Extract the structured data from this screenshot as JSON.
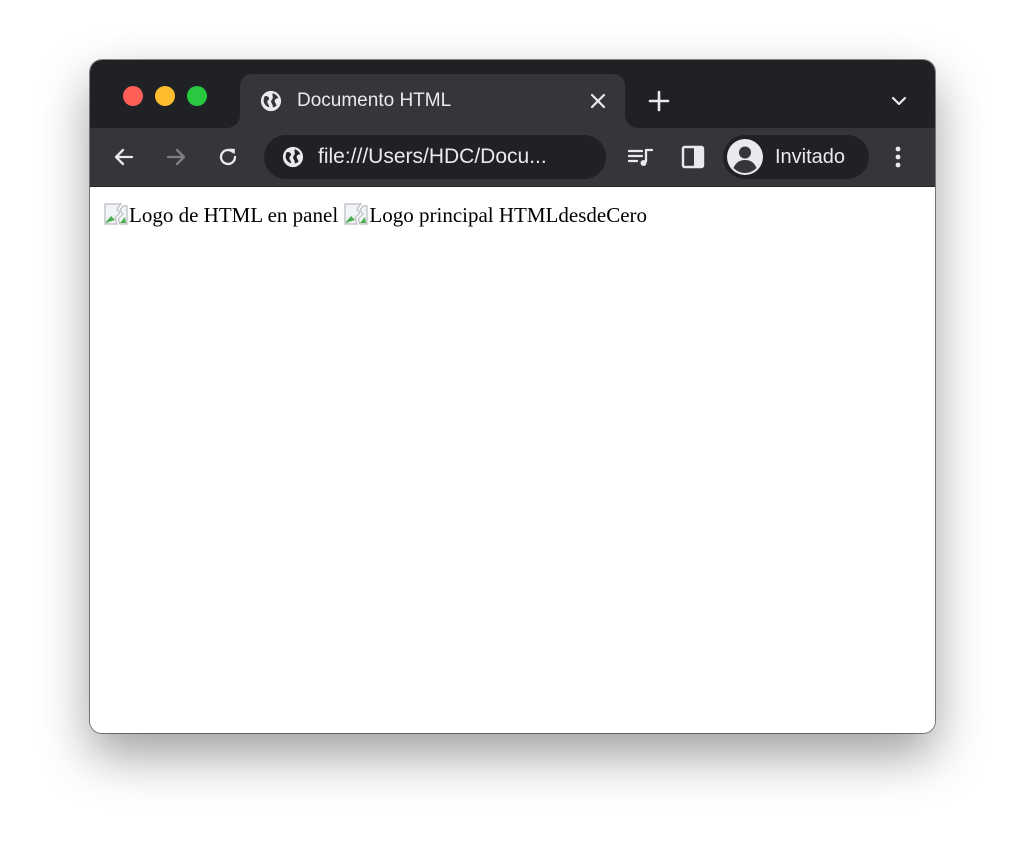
{
  "browser": {
    "tab": {
      "title": "Documento HTML",
      "favicon": "globe-icon"
    },
    "address_bar": {
      "url": "file:///Users/HDC/Docu..."
    },
    "profile": {
      "name": "Invitado"
    },
    "icons": {
      "window_controls": [
        "close",
        "minimize",
        "maximize"
      ],
      "toolbar": [
        "back-arrow-icon",
        "forward-arrow-icon",
        "reload-icon",
        "media-control-icon",
        "side-panel-icon",
        "menu-icon"
      ]
    }
  },
  "page": {
    "images": [
      {
        "alt": "Logo de HTML en panel",
        "status": "broken",
        "icon": "broken-image-icon"
      },
      {
        "alt": "Logo principal HTMLdesdeCero",
        "status": "broken",
        "icon": "broken-image-icon"
      }
    ]
  },
  "colors": {
    "tab_strip": "#202124",
    "toolbar": "#35363a",
    "close": "#ff5f57",
    "minimize": "#febc2e",
    "maximize": "#28c840",
    "text_light": "#e8eaed"
  }
}
